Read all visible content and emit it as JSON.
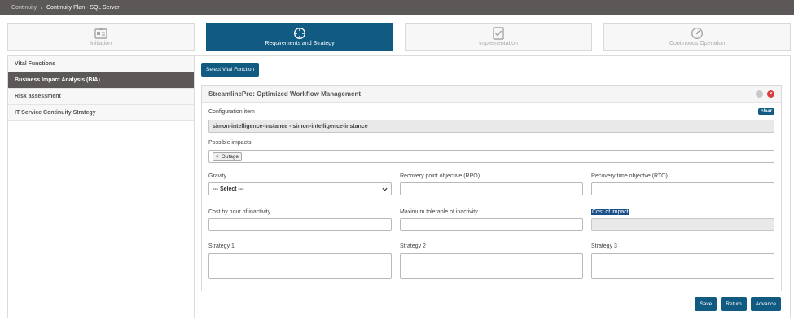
{
  "breadcrumb": {
    "root": "Continuity",
    "separator": "/",
    "current": "Continuity Plan - SQL Server"
  },
  "steps": [
    {
      "label": "Initiation",
      "icon": "id-card-icon",
      "active": false
    },
    {
      "label": "Requirements and Strategy",
      "icon": "target-icon",
      "active": true
    },
    {
      "label": "Implementation",
      "icon": "checklist-icon",
      "active": false
    },
    {
      "label": "Continuous Operation",
      "icon": "gauge-icon",
      "active": false
    }
  ],
  "sidebar": {
    "items": [
      {
        "label": "Vital Functions"
      },
      {
        "label": "Business Impact Analysis (BIA)"
      },
      {
        "label": "Risk assessment"
      },
      {
        "label": "IT Service Continuity Strategy"
      }
    ]
  },
  "main": {
    "select_vital_label": "Select Vital Function",
    "panel_title": "StreamlinePro: Optimized Workflow Management",
    "clear_label": "clear",
    "config_item_label": "Configuration item",
    "config_item_value": "simon-intelligence-instance - simon-intelligence-instance",
    "possible_impacts_label": "Possible impacts",
    "impact_tags": [
      {
        "label": "Outage"
      }
    ],
    "gravity_label": "Gravity",
    "gravity_value": "--- Select ---",
    "rpo_label": "Recovery point objective (RPO)",
    "rto_label": "Recovery time objectve (RTO)",
    "cost_hour_label": "Cost by hour of inactivity",
    "max_tolerable_label": "Maximum tolerable of inactivity",
    "cost_impact_label": "Cost of impact",
    "strategy1_label": "Strategy 1",
    "strategy2_label": "Strategy 2",
    "strategy3_label": "Strategy 3"
  },
  "footer": {
    "save_label": "Save",
    "return_label": "Return",
    "advance_label": "Advance"
  },
  "colors": {
    "primary": "#115b83",
    "topbar": "#5b5857",
    "close": "#d83c3c"
  }
}
